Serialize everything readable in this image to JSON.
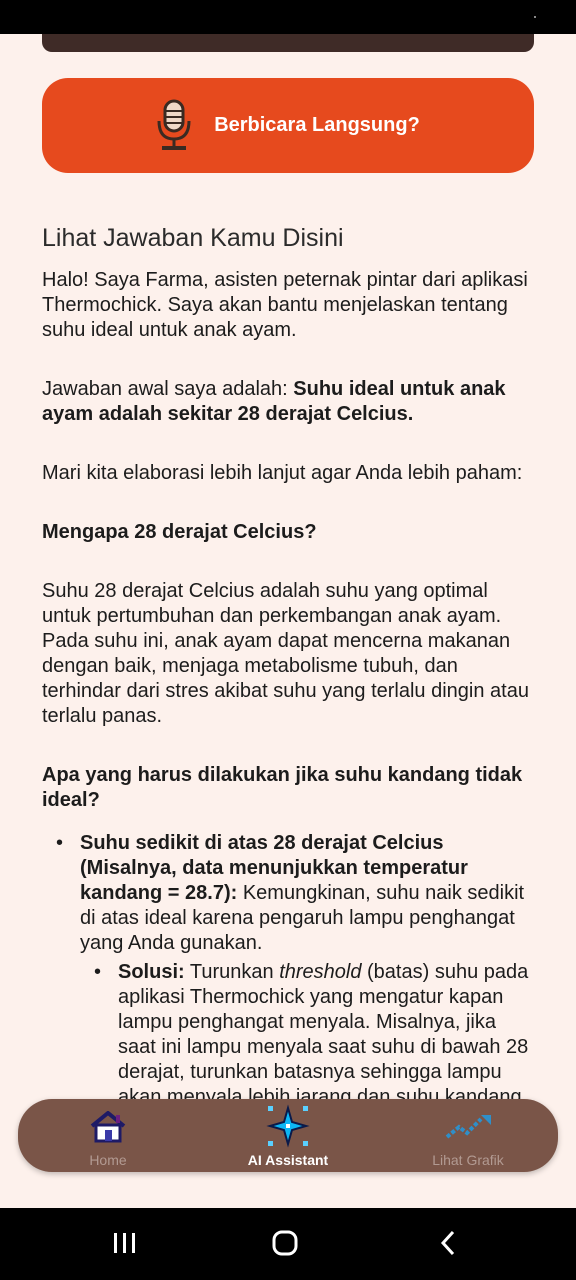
{
  "speak_button": {
    "label": "Berbicara Langsung?"
  },
  "answer": {
    "section_title": "Lihat Jawaban Kamu Disini",
    "intro": "Halo! Saya Farma, asisten peternak pintar dari aplikasi Thermochick. Saya akan bantu menjelaskan tentang suhu ideal untuk anak ayam.",
    "first_answer_prefix": "Jawaban awal saya adalah: ",
    "first_answer_bold": "Suhu ideal untuk anak ayam adalah sekitar 28 derajat Celcius.",
    "elaborate": "Mari kita elaborasi lebih lanjut agar Anda lebih paham:",
    "why_heading": "Mengapa 28 derajat Celcius?",
    "why_text": "Suhu 28 derajat Celcius adalah suhu yang optimal untuk pertumbuhan dan perkembangan anak ayam. Pada suhu ini, anak ayam dapat mencerna makanan dengan baik, menjaga metabolisme tubuh, dan terhindar dari stres akibat suhu yang terlalu dingin atau terlalu panas.",
    "what_heading": "Apa yang harus dilakukan jika suhu kandang tidak ideal?",
    "bullet1_bold": "Suhu sedikit di atas 28 derajat Celcius (Misalnya, data menunjukkan temperatur kandang = 28.7):",
    "bullet1_text": " Kemungkinan, suhu naik sedikit di atas ideal karena pengaruh lampu penghangat yang Anda gunakan.",
    "sub_bold": "Solusi:",
    "sub_text_1": " Turunkan ",
    "sub_italic": "threshold",
    "sub_text_2": " (batas) suhu pada aplikasi Thermochick yang mengatur kapan lampu penghangat menyala. Misalnya, jika saat ini lampu menyala saat suhu di bawah 28 derajat, turunkan batasnya sehingga lampu akan menyala lebih jarang dan suhu kandang dapat turun."
  },
  "nav": {
    "home": "Home",
    "ai": "AI Assistant",
    "grafik": "Lihat Grafik"
  },
  "colors": {
    "accent": "#e64a1e",
    "nav_bg": "#7a5548",
    "page_bg": "#fdf1ec"
  }
}
